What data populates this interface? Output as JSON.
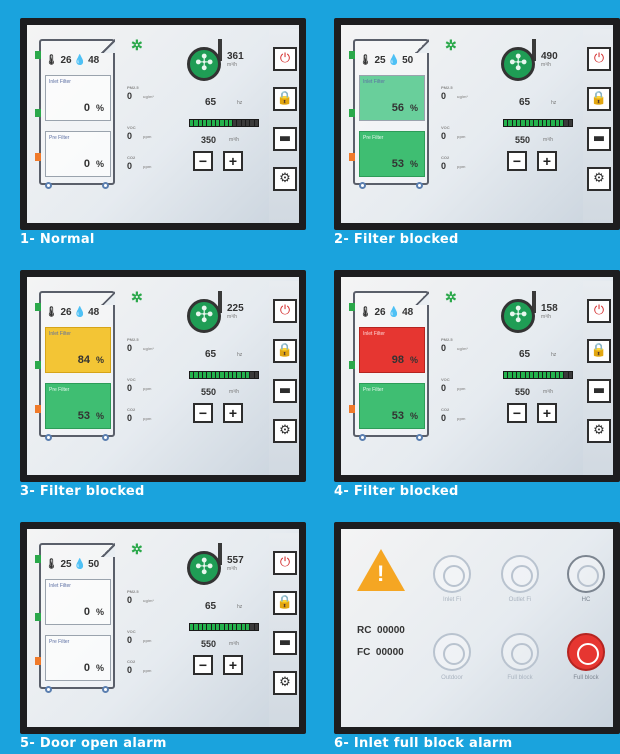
{
  "panels": [
    {
      "caption": "1- Normal",
      "temp_in": "26",
      "temp_out": "48",
      "inlet_filter_name": "Inlet Filter",
      "inlet_filter_value": "0",
      "inlet_filter_unit": "%",
      "fine_filter_name": "Pre Filter",
      "fine_filter_value": "0",
      "fine_filter_unit": "%",
      "pm25_label": "PM2.5",
      "pm25_value": "0",
      "pm25_unit": "ug/m³",
      "voc_label": "VOC",
      "voc_value": "0",
      "voc_unit": "ppm",
      "co2_label": "CO2",
      "co2_value": "0",
      "co2_unit": "ppm",
      "fan_speed": "361",
      "fan_speed_unit": "m³/h",
      "power_value": "65",
      "power_unit": "hz",
      "setpoint": "350",
      "setpoint_unit": "m³/h",
      "level_on": 10,
      "minus": "−",
      "plus": "+"
    },
    {
      "caption": "2- Filter blocked",
      "temp_in": "25",
      "temp_out": "50",
      "inlet_filter_name": "Inlet Filter",
      "inlet_filter_value": "56",
      "inlet_filter_unit": "%",
      "fine_filter_name": "Pre Filter",
      "fine_filter_value": "53",
      "fine_filter_unit": "%",
      "pm25_label": "PM2.5",
      "pm25_value": "0",
      "pm25_unit": "ug/m³",
      "voc_label": "VOC",
      "voc_value": "0",
      "voc_unit": "ppm",
      "co2_label": "CO2",
      "co2_value": "0",
      "co2_unit": "ppm",
      "fan_speed": "490",
      "fan_speed_unit": "m³/h",
      "power_value": "65",
      "power_unit": "hz",
      "setpoint": "550",
      "setpoint_unit": "m³/h",
      "level_on": 14,
      "minus": "−",
      "plus": "+"
    },
    {
      "caption": "3- Filter blocked",
      "temp_in": "26",
      "temp_out": "48",
      "inlet_filter_name": "Inlet Filter",
      "inlet_filter_value": "84",
      "inlet_filter_unit": "%",
      "fine_filter_name": "Pre Filter",
      "fine_filter_value": "53",
      "fine_filter_unit": "%",
      "pm25_label": "PM2.5",
      "pm25_value": "0",
      "pm25_unit": "ug/m³",
      "voc_label": "VOC",
      "voc_value": "0",
      "voc_unit": "ppm",
      "co2_label": "CO2",
      "co2_value": "0",
      "co2_unit": "ppm",
      "fan_speed": "225",
      "fan_speed_unit": "m³/h",
      "power_value": "65",
      "power_unit": "hz",
      "setpoint": "550",
      "setpoint_unit": "m³/h",
      "level_on": 14,
      "minus": "−",
      "plus": "+"
    },
    {
      "caption": "4- Filter blocked",
      "temp_in": "26",
      "temp_out": "48",
      "inlet_filter_name": "Inlet Filter",
      "inlet_filter_value": "98",
      "inlet_filter_unit": "%",
      "fine_filter_name": "Pre Filter",
      "fine_filter_value": "53",
      "fine_filter_unit": "%",
      "pm25_label": "PM2.5",
      "pm25_value": "0",
      "pm25_unit": "ug/m³",
      "voc_label": "VOC",
      "voc_value": "0",
      "voc_unit": "ppm",
      "co2_label": "CO2",
      "co2_value": "0",
      "co2_unit": "ppm",
      "fan_speed": "158",
      "fan_speed_unit": "m³/h",
      "power_value": "65",
      "power_unit": "hz",
      "setpoint": "550",
      "setpoint_unit": "m³/h",
      "level_on": 14,
      "minus": "−",
      "plus": "+"
    },
    {
      "caption": "5- Door open alarm",
      "temp_in": "25",
      "temp_out": "50",
      "inlet_filter_name": "Inlet Filter",
      "inlet_filter_value": "0",
      "inlet_filter_unit": "%",
      "fine_filter_name": "Pre Filter",
      "fine_filter_value": "0",
      "fine_filter_unit": "%",
      "pm25_label": "PM2.5",
      "pm25_value": "0",
      "pm25_unit": "ug/m³",
      "voc_label": "VOC",
      "voc_value": "0",
      "voc_unit": "ppm",
      "co2_label": "CO2",
      "co2_value": "0",
      "co2_unit": "ppm",
      "fan_speed": "557",
      "fan_speed_unit": "m³/h",
      "power_value": "65",
      "power_unit": "hz",
      "setpoint": "550",
      "setpoint_unit": "m³/h",
      "level_on": 14,
      "minus": "−",
      "plus": "+"
    }
  ],
  "alarm_panel": {
    "caption": "6- Inlet full block alarm",
    "rc_label": "RC",
    "rc_value": "00000",
    "fc_label": "FC",
    "fc_value": "00000",
    "icons": [
      {
        "label": "Inlet Fi",
        "state": "inactive"
      },
      {
        "label": "Outlet Fi",
        "state": "inactive"
      },
      {
        "label": "HC",
        "state": "dark"
      },
      {
        "label": "Outdoor",
        "state": "inactive"
      },
      {
        "label": "Full block",
        "state": "inactive"
      },
      {
        "label": "Full block",
        "state": "active"
      }
    ]
  },
  "colors": {
    "background": "#1aa3dd",
    "normal_filter": "#ffffff",
    "green_filter": "#3fbe72",
    "yellow_filter": "#f3c535",
    "red_filter": "#e63631",
    "alarm_triangle": "#f5a623"
  }
}
